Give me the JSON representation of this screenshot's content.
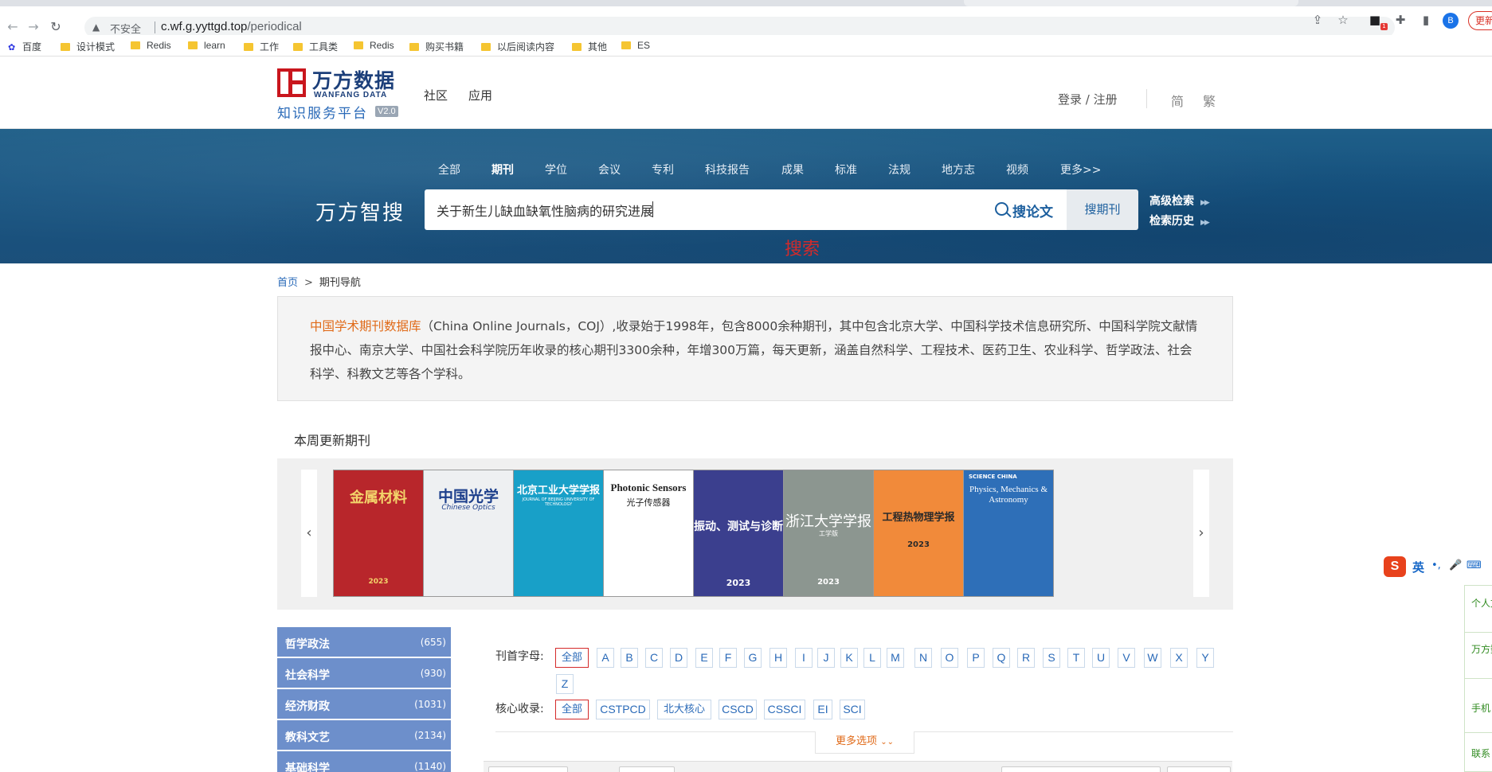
{
  "browser": {
    "insecure_label": "不安全",
    "url_host": "c.wf.g.yyttgd.top",
    "url_path": "/periodical",
    "profile_initial": "B",
    "ext_badge": "1",
    "update_label": "更新",
    "bookmarks": [
      "百度",
      "设计模式",
      "Redis",
      "learn",
      "工作",
      "工具类",
      "Redis",
      "购买书籍",
      "以后阅读内容",
      "其他",
      "ES"
    ]
  },
  "header": {
    "logo_cn": "万方数据",
    "logo_en": "WANFANG DATA",
    "logo_sub": "知识服务平台",
    "logo_version": "V2.0",
    "nav": [
      "社区",
      "应用"
    ],
    "login": "登录 / 注册",
    "lang_simplified": "简",
    "lang_traditional": "繁"
  },
  "search": {
    "types": [
      "全部",
      "期刊",
      "学位",
      "会议",
      "专利",
      "科技报告",
      "成果",
      "标准",
      "法规",
      "地方志",
      "视频",
      "更多>>"
    ],
    "active_type": "期刊",
    "label": "万方智搜",
    "query": "关于新生儿缺血缺氧性脑病的研究进展",
    "search_paper": "搜论文",
    "search_journal": "搜期刊",
    "advanced": "高级检索",
    "history": "检索历史",
    "red_label": "搜索"
  },
  "breadcrumb": {
    "home": "首页",
    "separator": ">",
    "current": "期刊导航"
  },
  "intro": {
    "highlight": "中国学术期刊数据库",
    "text": "（China Online Journals，COJ）,收录始于1998年，包含8000余种期刊，其中包含北京大学、中国科学技术信息研究所、中国科学院文献情报中心、南京大学、中国社会科学院历年收录的核心期刊3300余种，年增300万篇，每天更新，涵盖自然科学、工程技术、医药卫生、农业科学、哲学政法、社会科学、科教文艺等各个学科。"
  },
  "weekly": {
    "title": "本周更新期刊",
    "prev": "‹",
    "next": "›",
    "covers": [
      {
        "title": "金属材料",
        "year": "2023",
        "bg": "#b8262b",
        "fg": "#f3d36a"
      },
      {
        "title": "中国光学",
        "sub": "Chinese Optics",
        "year": "",
        "bg": "#eef0f2",
        "fg": "#1d3f8c"
      },
      {
        "title": "北京工业大学学报",
        "sub": "JOURNAL OF BEIJING UNIVERSITY OF TECHNOLOGY",
        "year": "",
        "bg": "#18a0c8",
        "fg": "#ffffff"
      },
      {
        "title": "Photonic Sensors",
        "sub": "光子传感器",
        "year": "",
        "bg": "#ffffff",
        "fg": "#222222"
      },
      {
        "title": "振动、测试与诊断",
        "year": "2023",
        "bg": "#3b3f8e",
        "fg": "#ffffff"
      },
      {
        "title": "浙江大学学报",
        "sub": "工学版",
        "year": "2023",
        "bg": "#8c9690",
        "fg": "#ffffff"
      },
      {
        "title": "工程热物理学报",
        "year": "2023",
        "bg": "#f18a3a",
        "fg": "#2a2a2a"
      },
      {
        "title": "Physics, Mechanics & Astronomy",
        "sub": "SCIENCE CHINA",
        "year": "",
        "bg": "#2e6fb8",
        "fg": "#ffffff"
      }
    ]
  },
  "categories": [
    {
      "name": "哲学政法",
      "count": "(655)"
    },
    {
      "name": "社会科学",
      "count": "(930)"
    },
    {
      "name": "经济财政",
      "count": "(1031)"
    },
    {
      "name": "教科文艺",
      "count": "(2134)"
    },
    {
      "name": "基础科学",
      "count": "(1140)"
    }
  ],
  "filters": {
    "initial_label": "刊首字母:",
    "initials": [
      "全部",
      "A",
      "B",
      "C",
      "D",
      "E",
      "F",
      "G",
      "H",
      "I",
      "J",
      "K",
      "L",
      "M",
      "N",
      "O",
      "P",
      "Q",
      "R",
      "S",
      "T",
      "U",
      "V",
      "W",
      "X",
      "Y",
      "Z"
    ],
    "core_label": "核心收录:",
    "cores": [
      "全部",
      "CSTPCD",
      "北大核心",
      "CSCD",
      "CSSCI",
      "EI",
      "SCI"
    ],
    "more": "更多选项"
  },
  "ime": {
    "logo": "S",
    "lang": "英"
  },
  "right_float": [
    "个人文献检测",
    "万方数据京东",
    "手机",
    "联系"
  ]
}
